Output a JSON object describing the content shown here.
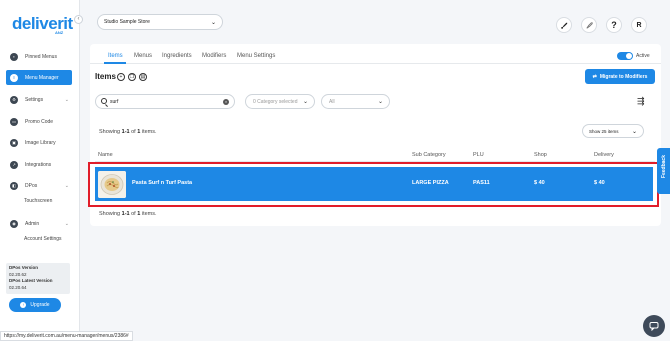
{
  "sidebar": {
    "logo": "deliverit",
    "logo_sub": "ANZ",
    "collapse_icon": "‹",
    "items": [
      {
        "label": "Pinned Menus",
        "icon": "pin-icon"
      },
      {
        "label": "Menu Manager",
        "icon": "menu-icon"
      },
      {
        "label": "Settings",
        "icon": "gear-icon"
      },
      {
        "label": "Promo Code",
        "icon": "ticket-icon"
      },
      {
        "label": "Image Library",
        "icon": "image-icon"
      },
      {
        "label": "Integrations",
        "icon": "plug-icon"
      },
      {
        "label": "DPos",
        "icon": "pos-icon"
      },
      {
        "label": "Admin",
        "icon": "admin-icon"
      }
    ],
    "subitems": {
      "dpos": "Touchscreen",
      "admin": "Account Settings"
    },
    "version": {
      "dpos_label": "DPos Version",
      "dpos_value": "02.20.62",
      "latest_label": "DPos Latest Version",
      "latest_value": "02.20.64"
    },
    "upgrade_label": "Upgrade"
  },
  "header": {
    "store": "Studio Sample Store",
    "buttons": [
      "rocket-icon",
      "rocket-outline-icon",
      "help-icon",
      "avatar"
    ],
    "help_glyph": "?",
    "avatar": "R"
  },
  "tabs": [
    "Items",
    "Menus",
    "Ingredients",
    "Modifiers",
    "Menu Settings"
  ],
  "active_toggle": {
    "label": "Active",
    "on": true
  },
  "items_section": {
    "title": "Items",
    "migrate_label": "Migrate to Modifiers",
    "search_value": "surf",
    "category_placeholder": "0 Category selected",
    "status_placeholder": "All",
    "showing_prefix": "Showing",
    "showing_range": "1-1",
    "showing_of": "of",
    "showing_total": "1",
    "showing_suffix": "items.",
    "per_page": "Show 25 items"
  },
  "table": {
    "headers": [
      "Name",
      "Sub Category",
      "PLU",
      "Shop",
      "Delivery"
    ],
    "rows": [
      {
        "name": "Pasta Surf n Turf Pasta",
        "sub_category": "LARGE PIZZA",
        "plu": "PAS11",
        "shop": "$ 40",
        "delivery": "$ 40"
      }
    ]
  },
  "feedback_label": "Feedback",
  "status_url": "https://my.deliverit.com.au/menu-manager/menus/2386#",
  "colors": {
    "accent": "#1e88e5",
    "highlight": "#e11d2a",
    "dark": "#3e4a5a"
  }
}
